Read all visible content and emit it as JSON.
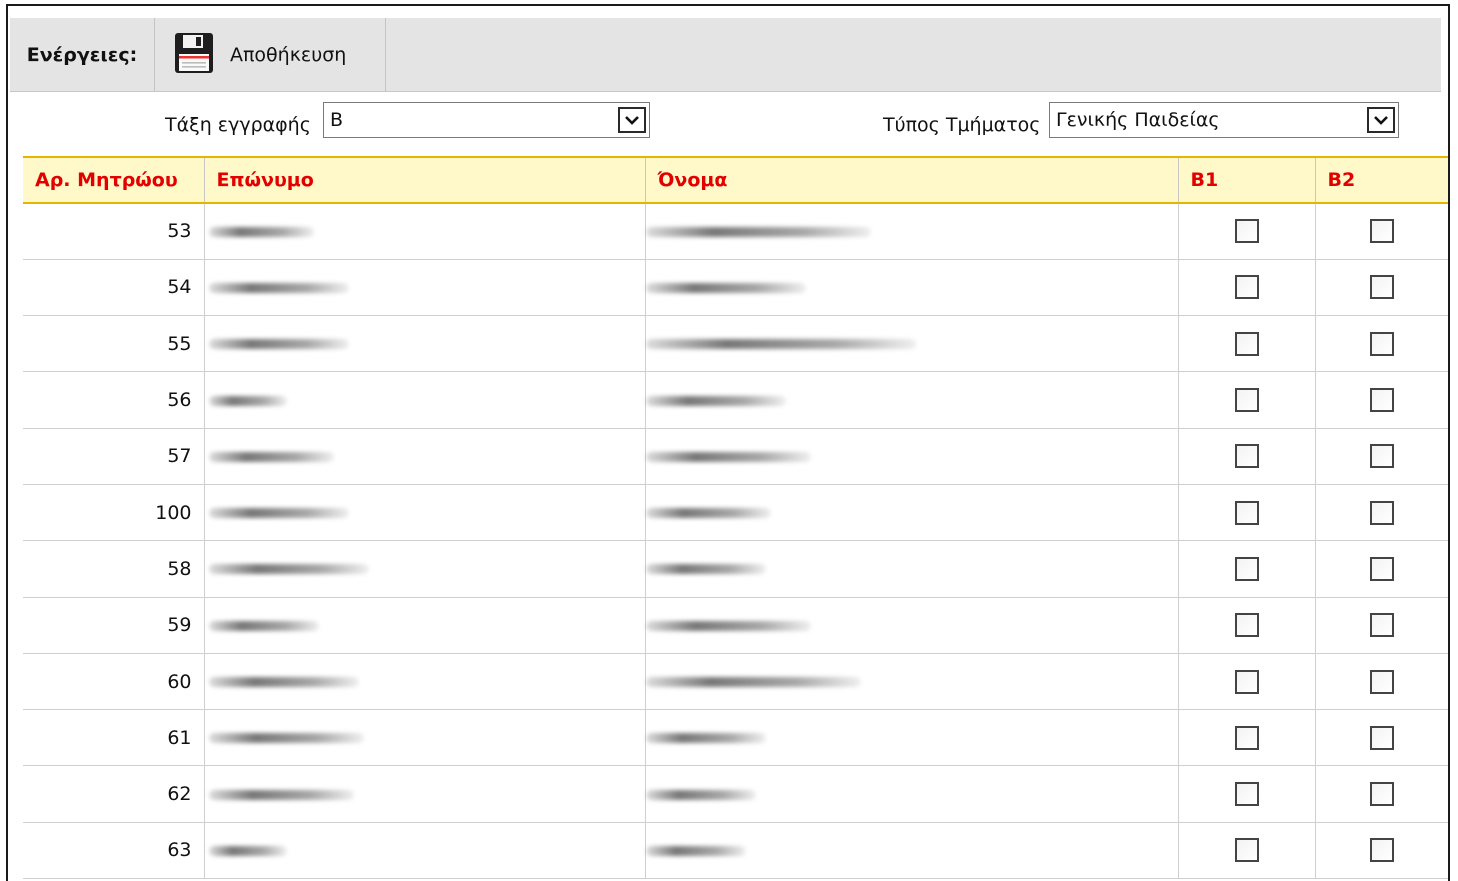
{
  "toolbar": {
    "actions_label": "Ενέργειες:",
    "save_label": "Αποθήκευση"
  },
  "filters": {
    "class_label": "Τάξη εγγραφής",
    "class_value": "Β",
    "section_type_label": "Τύπος Τμήματος",
    "section_type_value": "Γενικής Παιδείας"
  },
  "table": {
    "columns": [
      "Αρ. Μητρώου",
      "Επώνυμο",
      "Όνομα",
      "Β1",
      "Β2"
    ],
    "rows": [
      {
        "registry_no": "53",
        "b1": false,
        "b2": false
      },
      {
        "registry_no": "54",
        "b1": false,
        "b2": false
      },
      {
        "registry_no": "55",
        "b1": false,
        "b2": false
      },
      {
        "registry_no": "56",
        "b1": false,
        "b2": false
      },
      {
        "registry_no": "57",
        "b1": false,
        "b2": false
      },
      {
        "registry_no": "100",
        "b1": false,
        "b2": false
      },
      {
        "registry_no": "58",
        "b1": false,
        "b2": false
      },
      {
        "registry_no": "59",
        "b1": false,
        "b2": false
      },
      {
        "registry_no": "60",
        "b1": false,
        "b2": false
      },
      {
        "registry_no": "61",
        "b1": false,
        "b2": false
      },
      {
        "registry_no": "62",
        "b1": false,
        "b2": false
      },
      {
        "registry_no": "63",
        "b1": false,
        "b2": false
      }
    ]
  },
  "colors": {
    "header_text": "#e30000",
    "header_bg": "#fff8c8",
    "header_border": "#e5b500",
    "toolbar_bg": "#e4e4e4"
  },
  "icons": {
    "save": "floppy-disk-icon",
    "dropdown": "chevron-down-icon"
  }
}
